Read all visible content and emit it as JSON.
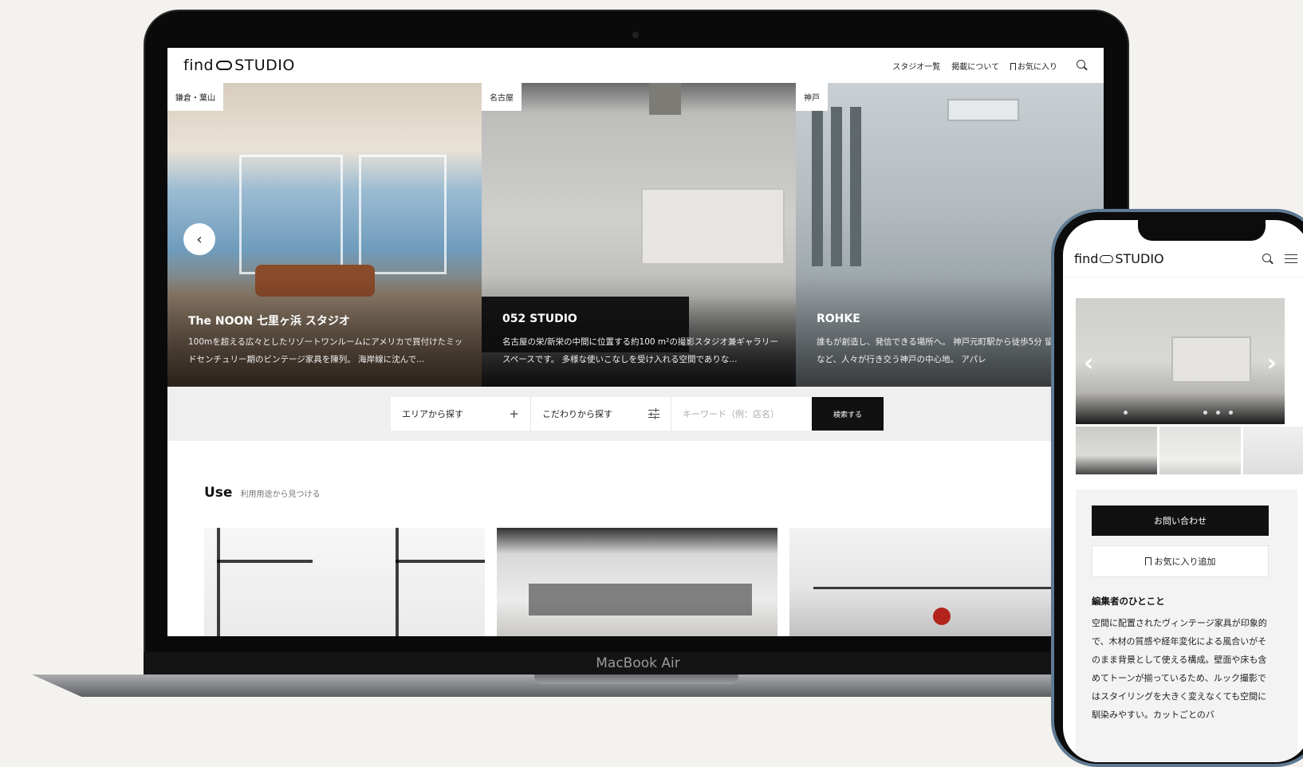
{
  "laptop": {
    "device_label": "MacBook Air",
    "site": {
      "logo_left": "find",
      "logo_right": "STUDIO",
      "nav": [
        "スタジオ一覧",
        "掲載について",
        "お気に入り"
      ]
    },
    "slides": [
      {
        "tag": "鎌倉・葉山",
        "title": "The NOON 七里ヶ浜 スタジオ",
        "desc": "100mを超える広々としたリゾートワンルームにアメリカで買付けたミッドセンチュリー期のビンテージ家具を陳列。 海岸線に沈んで..."
      },
      {
        "tag": "名古屋",
        "title": "052 STUDIO",
        "desc": "名古屋の栄/新栄の中間に位置する約100 m²の撮影スタジオ兼ギャラリースペースです。 多様な使いこなしを受け入れる空間でありな..."
      },
      {
        "tag": "神戸",
        "title": "ROHKE",
        "desc": "誰もが創造し、発信できる場所へ。 神戸元町駅から徒歩5分 留地や中華街など、人々が行き交う神戸の中心地。 アパレ"
      }
    ],
    "search": {
      "area_label": "エリアから探す",
      "area_icon": "plus-icon",
      "feature_label": "こだわりから探す",
      "feature_icon": "filter-icon",
      "keyword_placeholder": "キーワード（例：店名）",
      "submit_label": "検索する"
    },
    "use_section": {
      "title": "Use",
      "subtitle": "利用用途から見つける"
    }
  },
  "phone": {
    "logo_left": "find",
    "logo_right": "STUDIO",
    "contact_label": "お問い合わせ",
    "favorite_label": "お気に入り追加",
    "editor_title": "編集者のひとこと",
    "editor_text": "空間に配置されたヴィンテージ家具が印象的で、木材の質感や経年変化による風合いがそのまま背景として使える構成。壁面や床も含めてトーンが揃っているため、ルック撮影ではスタイリングを大きく変えなくても空間に馴染みやすい。カットごとのバ"
  },
  "colors": {
    "accent": "#111111",
    "band": "#efefef",
    "phone_frame": "#5f7a93"
  }
}
